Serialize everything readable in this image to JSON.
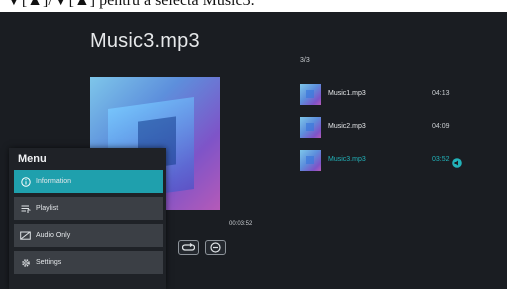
{
  "caption": "▼[▲]/▼[▲] pentru a selecta Music3.",
  "player": {
    "title": "Music3.mp3",
    "elapsed": "00:03:52"
  },
  "menu": {
    "title": "Menu",
    "items": [
      {
        "label": "Information",
        "icon": "info-icon",
        "active": true
      },
      {
        "label": "Playlist",
        "icon": "playlist-icon",
        "active": false
      },
      {
        "label": "Audio Only",
        "icon": "audio-only-icon",
        "active": false
      },
      {
        "label": "Settings",
        "icon": "gear-icon",
        "active": false
      }
    ]
  },
  "playlist": {
    "count": "3/3",
    "tracks": [
      {
        "name": "Music1.mp3",
        "duration": "04:13",
        "current": false
      },
      {
        "name": "Music2.mp3",
        "duration": "04:09",
        "current": false
      },
      {
        "name": "Music3.mp3",
        "duration": "03:52",
        "current": true
      }
    ]
  },
  "colors": {
    "background": "#1a1d22",
    "accent": "#1fa0ad",
    "highlight_text": "#22b2b9",
    "menu_item": "#3b3f45"
  }
}
